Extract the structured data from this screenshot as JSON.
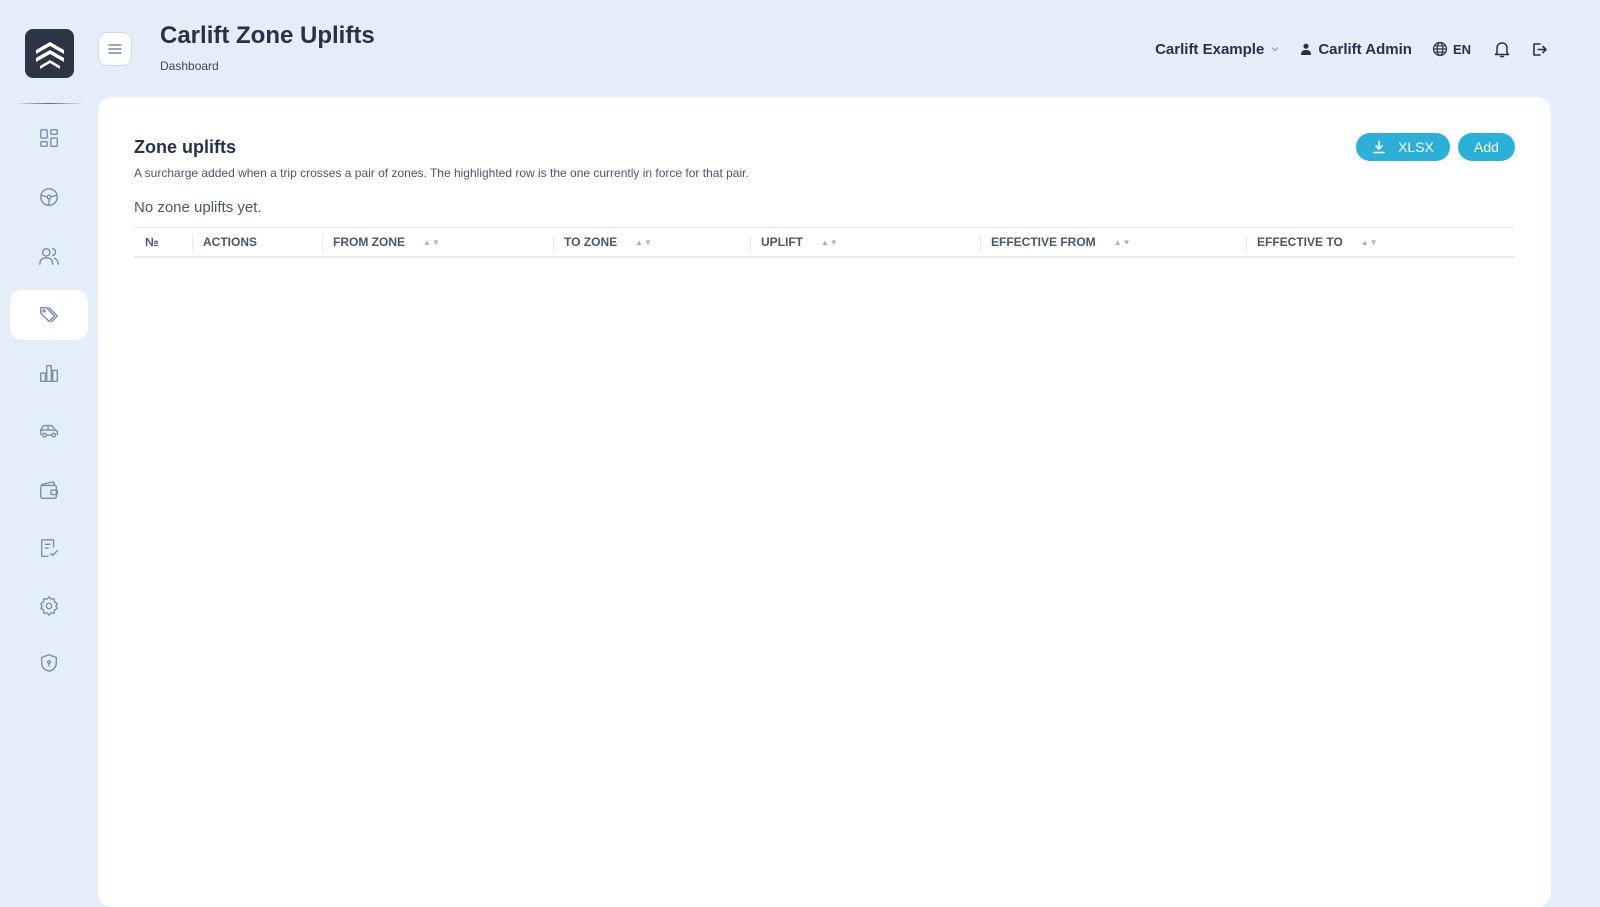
{
  "header": {
    "title": "Carlift Zone Uplifts",
    "breadcrumb": "Dashboard",
    "company": "Carlift Example",
    "user": "Carlift Admin",
    "language": "EN"
  },
  "sidebar": {
    "items": [
      {
        "icon": "dashboard-icon",
        "active": false
      },
      {
        "icon": "steering-wheel-icon",
        "active": false
      },
      {
        "icon": "users-icon",
        "active": false
      },
      {
        "icon": "tags-icon",
        "active": true
      },
      {
        "icon": "chart-icon",
        "active": false
      },
      {
        "icon": "car-icon",
        "active": false
      },
      {
        "icon": "wallet-icon",
        "active": false
      },
      {
        "icon": "checklist-icon",
        "active": false
      },
      {
        "icon": "settings-icon",
        "active": false
      },
      {
        "icon": "shield-icon",
        "active": false
      }
    ]
  },
  "main": {
    "title": "Zone uplifts",
    "description": "A surcharge added when a trip crosses a pair of zones. The highlighted row is the one currently in force for that pair.",
    "empty_message": "No zone uplifts yet.",
    "buttons": {
      "xlsx": "XLSX",
      "add": "Add"
    },
    "table": {
      "columns": [
        "№",
        "ACTIONS",
        "FROM ZONE",
        "TO ZONE",
        "UPLIFT",
        "EFFECTIVE FROM",
        "EFFECTIVE TO"
      ],
      "sort_glyph": "▲▼",
      "rows": []
    }
  },
  "colors": {
    "background": "#e3eef8",
    "accent": "#2bb0d8",
    "logo_bg": "#2c3445",
    "text_primary": "#27324a"
  }
}
